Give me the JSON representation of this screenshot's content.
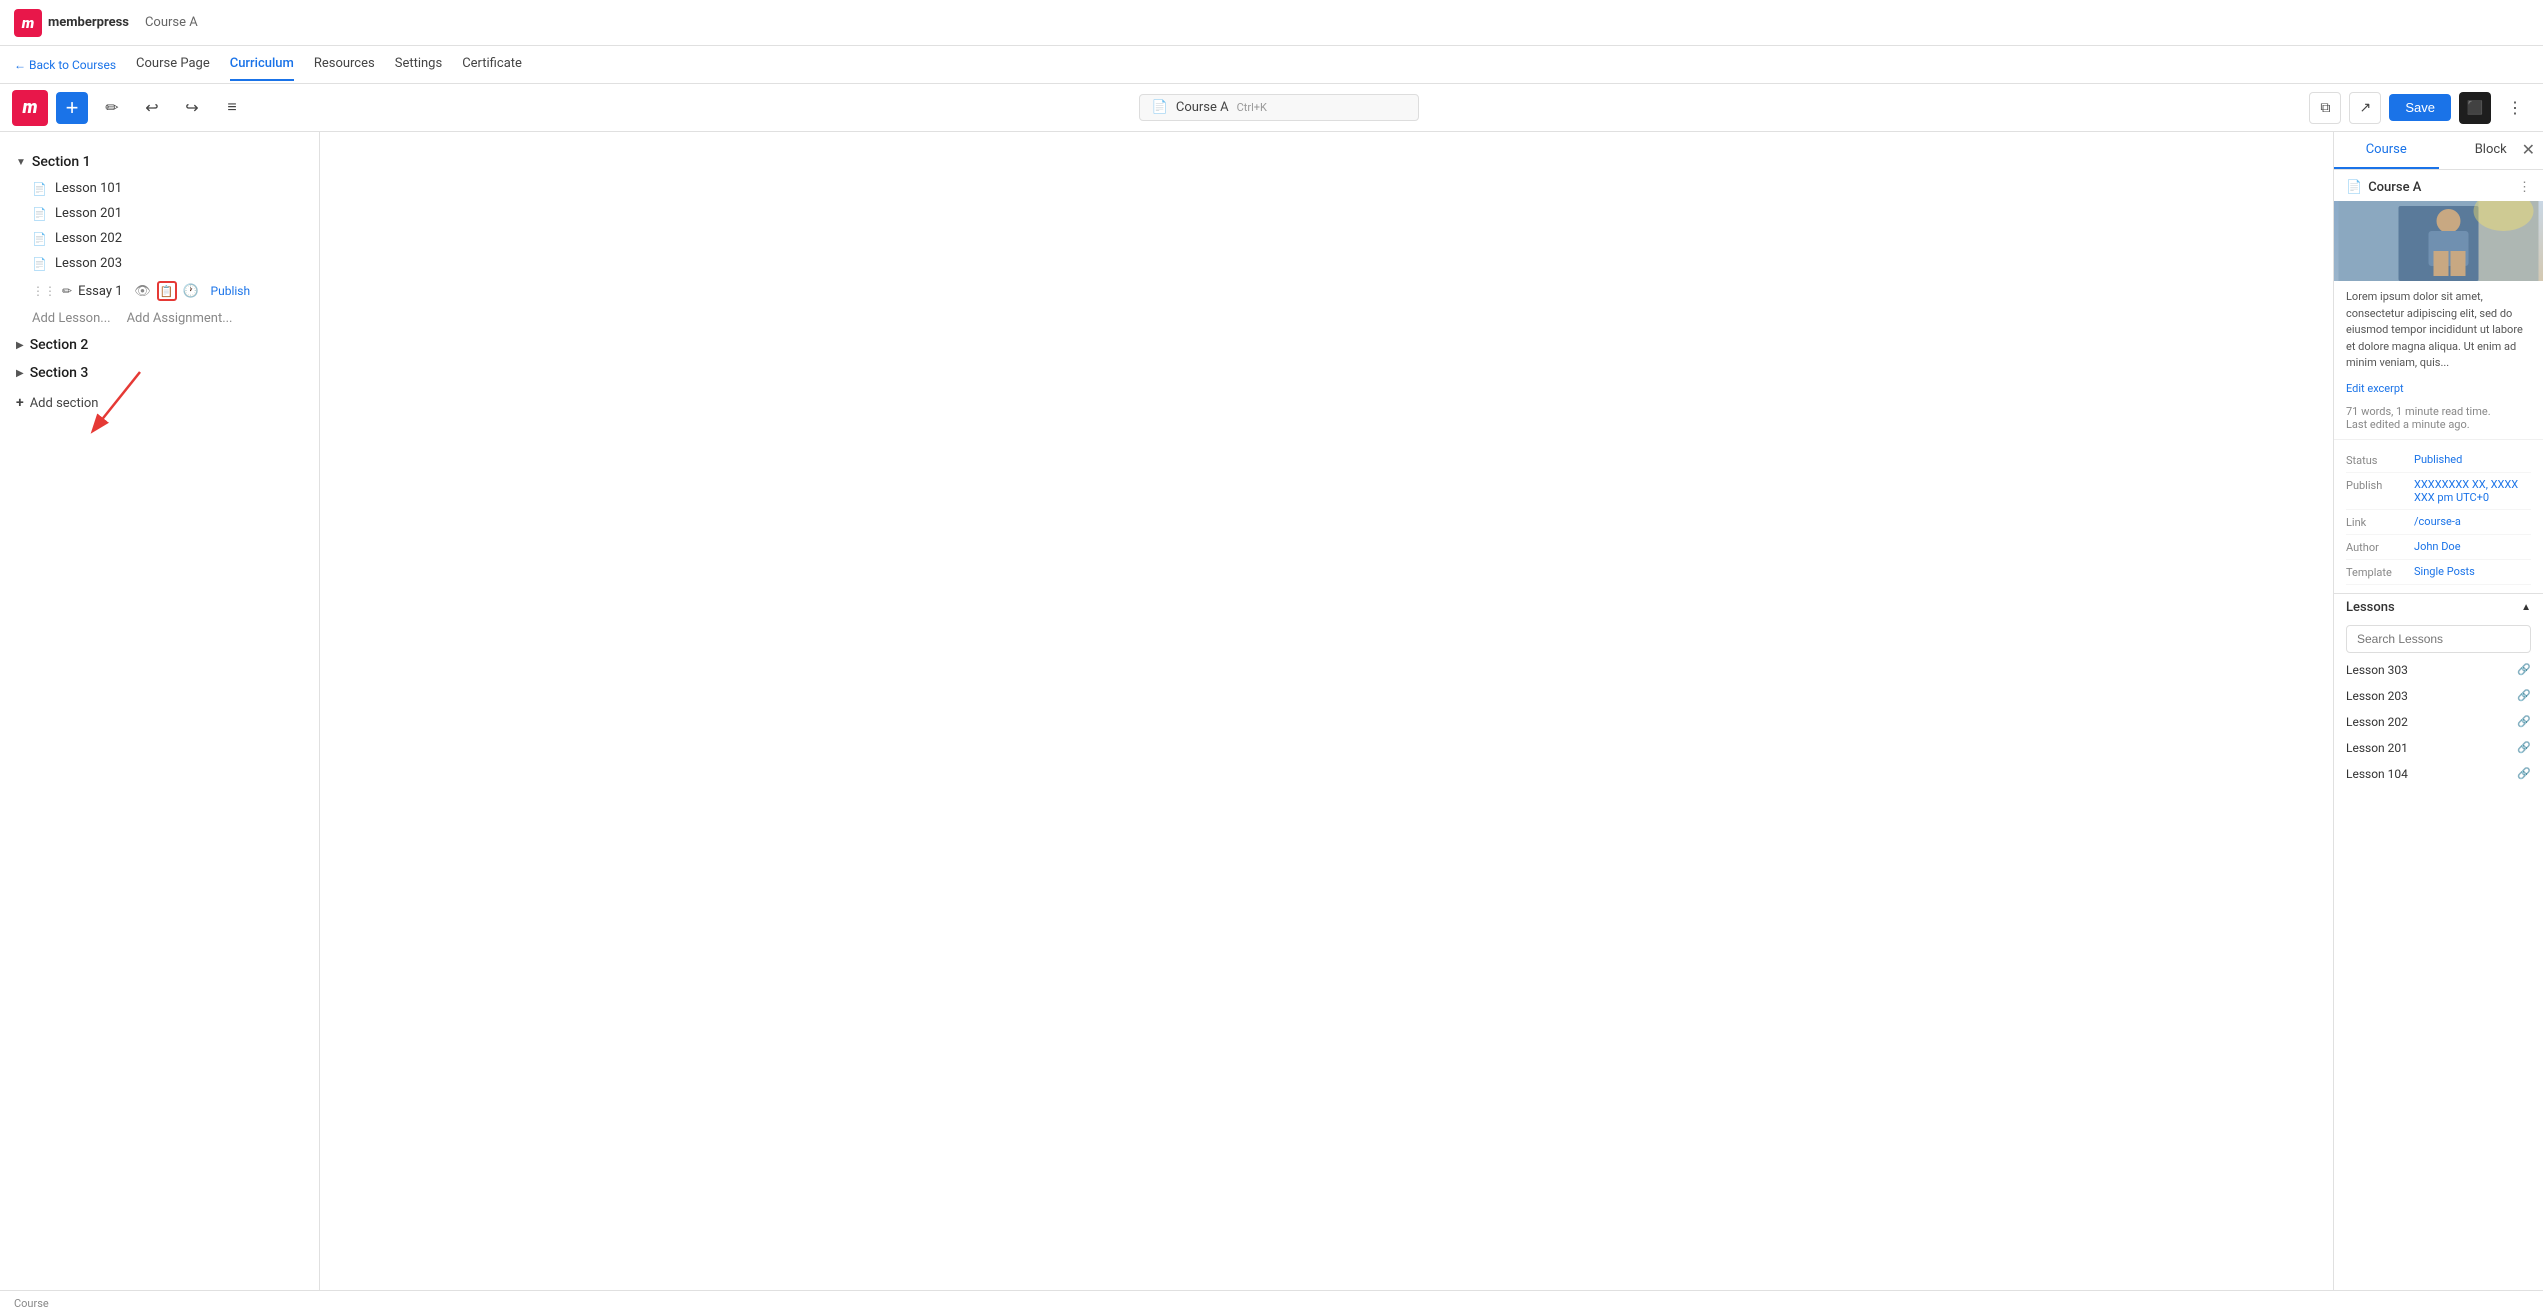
{
  "app": {
    "logo_letter": "m",
    "logo_name": "memberpress",
    "course_name": "Course A"
  },
  "nav": {
    "back_label": "← Back to Courses",
    "tabs": [
      "Course Page",
      "Curriculum",
      "Resources",
      "Settings",
      "Certificate"
    ],
    "active_tab": "Curriculum"
  },
  "toolbar": {
    "doc_icon": "📄",
    "doc_name": "Course A",
    "shortcut": "Ctrl+K",
    "save_label": "Save",
    "undo_icon": "↩",
    "redo_icon": "↪",
    "list_icon": "≡",
    "pencil_icon": "✏",
    "add_icon": "+",
    "view_icon": "⧉",
    "external_icon": "↗",
    "dark_icon": "⬛",
    "more_icon": "⋮"
  },
  "curriculum": {
    "sections": [
      {
        "id": "section1",
        "label": "Section 1",
        "expanded": true,
        "lessons": [
          {
            "id": "l101",
            "label": "Lesson 101"
          },
          {
            "id": "l201",
            "label": "Lesson 201"
          },
          {
            "id": "l202",
            "label": "Lesson 202"
          },
          {
            "id": "l203",
            "label": "Lesson 203"
          }
        ],
        "essays": [
          {
            "id": "essay1",
            "label": "Essay 1",
            "has_highlight": true,
            "publish_label": "Publish"
          }
        ],
        "add_lesson_label": "Add Lesson...",
        "add_assignment_label": "Add Assignment..."
      },
      {
        "id": "section2",
        "label": "Section 2",
        "expanded": false,
        "lessons": [],
        "essays": []
      },
      {
        "id": "section3",
        "label": "Section 3",
        "expanded": false,
        "lessons": [],
        "essays": []
      }
    ],
    "add_section_label": "Add section"
  },
  "right_panel": {
    "tabs": [
      "Course",
      "Block"
    ],
    "active_tab": "Course",
    "course": {
      "title": "Course A",
      "more_icon": "⋮",
      "excerpt": "Lorem ipsum dolor sit amet, consectetur adipiscing elit, sed do eiusmod tempor incididunt ut labore et dolore magna aliqua. Ut enim ad minim veniam, quis...",
      "edit_excerpt_label": "Edit excerpt",
      "word_count": "71 words, 1 minute read time.",
      "last_edited": "Last edited a minute ago.",
      "meta": [
        {
          "label": "Status",
          "value": "Published",
          "is_link": true
        },
        {
          "label": "Publish",
          "value": "XXXXXXXX XX, XXXX XXX pm UTC+0",
          "is_link": true
        },
        {
          "label": "Link",
          "value": "/course-a",
          "is_link": true
        },
        {
          "label": "Author",
          "value": "John Doe",
          "is_link": true
        },
        {
          "label": "Template",
          "value": "Single Posts",
          "is_link": true
        }
      ]
    },
    "lessons_section": {
      "header": "Lessons",
      "search_placeholder": "Search Lessons",
      "items": [
        {
          "label": "Lesson 303",
          "has_link": true
        },
        {
          "label": "Lesson 203",
          "has_link": true
        },
        {
          "label": "Lesson 202",
          "has_link": true
        },
        {
          "label": "Lesson 201",
          "has_link": true
        },
        {
          "label": "Lesson 104",
          "has_link": true
        }
      ]
    }
  },
  "status_bar": {
    "text": "Course"
  }
}
